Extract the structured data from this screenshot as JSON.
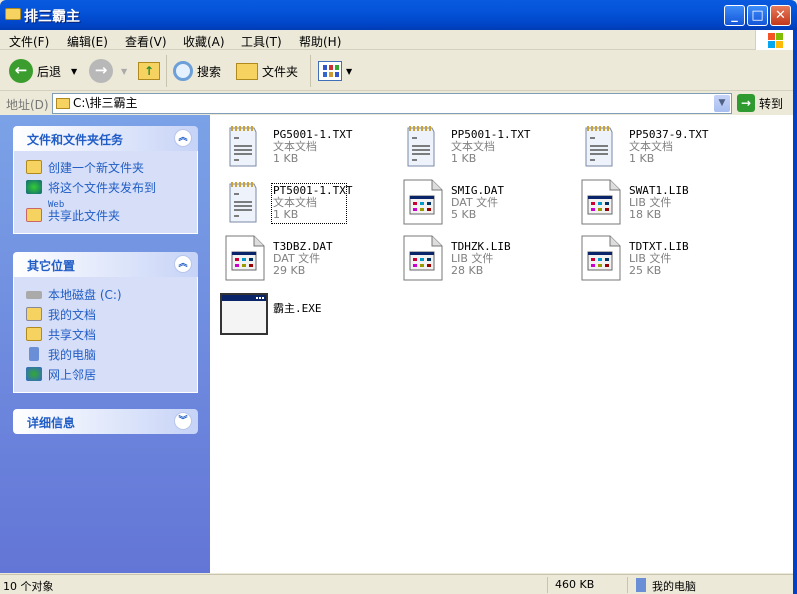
{
  "window": {
    "title": "排三霸主",
    "minimize": "_",
    "maximize": "□",
    "close": "✕"
  },
  "menu": [
    "文件(F)",
    "编辑(E)",
    "查看(V)",
    "收藏(A)",
    "工具(T)",
    "帮助(H)"
  ],
  "toolbar": {
    "back": "后退",
    "search": "搜索",
    "folders": "文件夹"
  },
  "address": {
    "label": "地址(D)",
    "value": "C:\\排三霸主",
    "go": "转到"
  },
  "tasks": {
    "title": "文件和文件夹任务",
    "items": [
      "创建一个新文件夹",
      "将这个文件夹发布到",
      "共享此文件夹"
    ],
    "web": "Web"
  },
  "places": {
    "title": "其它位置",
    "items": [
      "本地磁盘 (C:)",
      "我的文档",
      "共享文档",
      "我的电脑",
      "网上邻居"
    ]
  },
  "details": {
    "title": "详细信息"
  },
  "files": [
    {
      "name": "PG5001-1.TXT",
      "type": "文本文档",
      "size": "1 KB",
      "icon": "text"
    },
    {
      "name": "PP5001-1.TXT",
      "type": "文本文档",
      "size": "1 KB",
      "icon": "text"
    },
    {
      "name": "PP5037-9.TXT",
      "type": "文本文档",
      "size": "1 KB",
      "icon": "text"
    },
    {
      "name": "PT5001-1.TXT",
      "type": "文本文档",
      "size": "1 KB",
      "icon": "text",
      "focused": true
    },
    {
      "name": "SMIG.DAT",
      "type": "DAT 文件",
      "size": "5 KB",
      "icon": "data"
    },
    {
      "name": "SWAT1.LIB",
      "type": "LIB 文件",
      "size": "18 KB",
      "icon": "data"
    },
    {
      "name": "T3DBZ.DAT",
      "type": "DAT 文件",
      "size": "29 KB",
      "icon": "data"
    },
    {
      "name": "TDHZK.LIB",
      "type": "LIB 文件",
      "size": "28 KB",
      "icon": "data"
    },
    {
      "name": "TDTXT.LIB",
      "type": "LIB 文件",
      "size": "25 KB",
      "icon": "data"
    },
    {
      "name": "霸主.EXE",
      "type": "",
      "size": "",
      "icon": "exe"
    }
  ],
  "status": {
    "count": "10 个对象",
    "size": "460 KB",
    "location": "我的电脑"
  }
}
